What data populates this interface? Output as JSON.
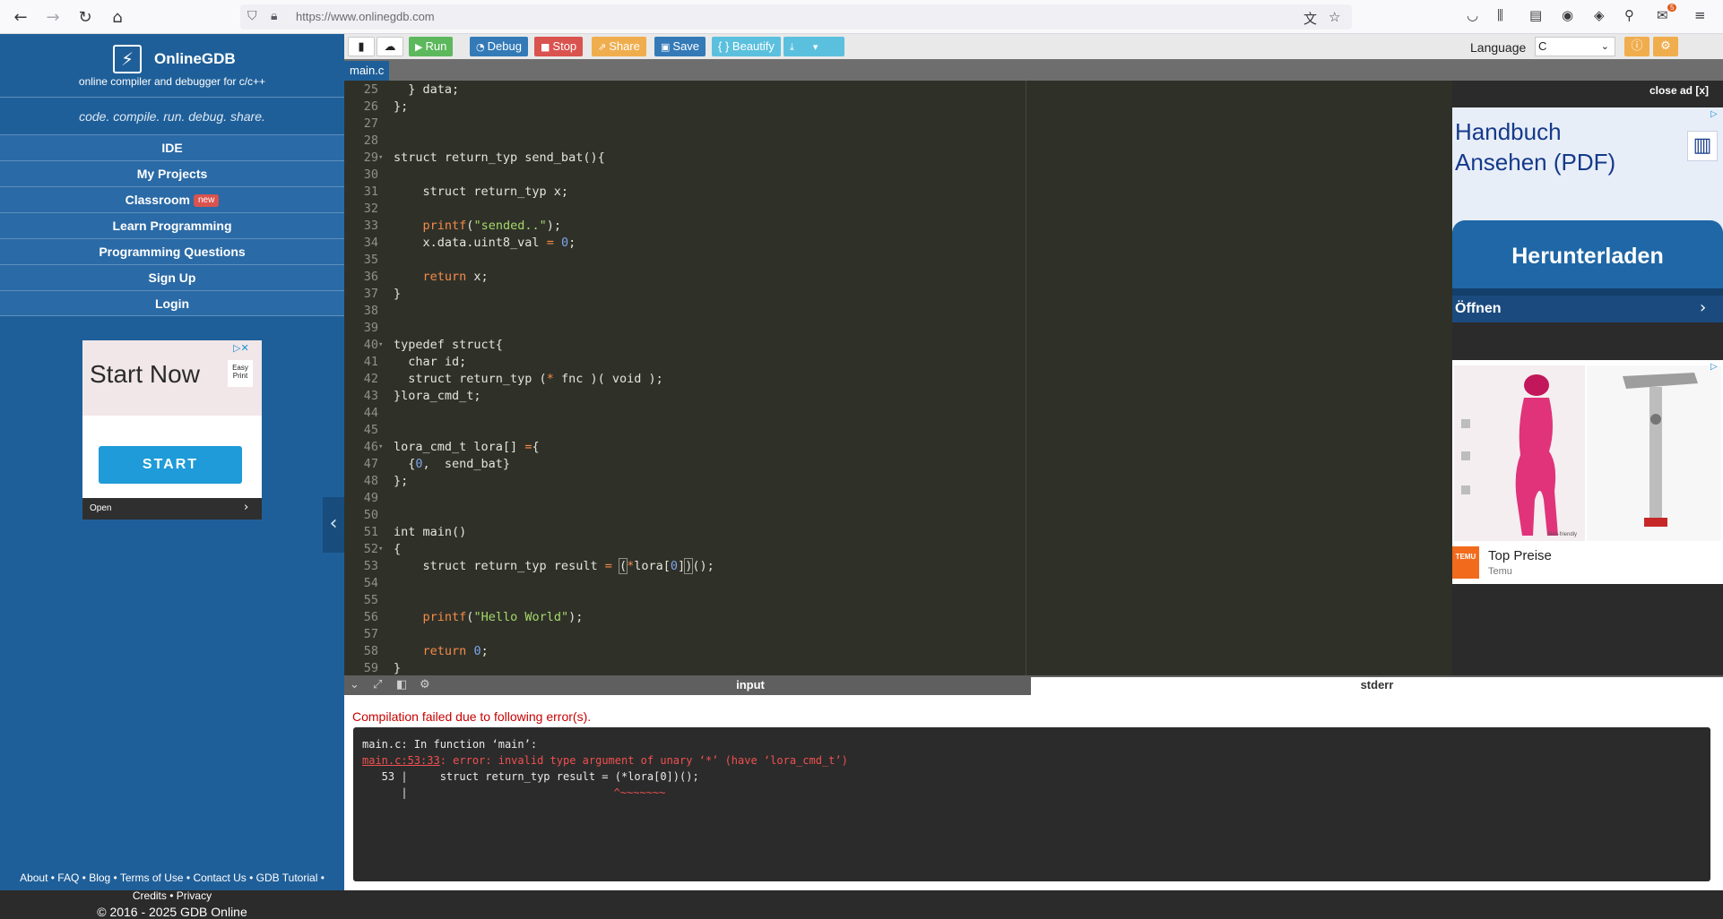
{
  "browser": {
    "url": "https://www.onlinegdb.com",
    "extension_badge": "5"
  },
  "sidebar": {
    "brand": "OnlineGDB",
    "tagline": "online compiler and debugger for c/c++",
    "motto": "code. compile. run. debug. share.",
    "menu": [
      {
        "label": "IDE"
      },
      {
        "label": "My Projects"
      },
      {
        "label": "Classroom",
        "badge": "new"
      },
      {
        "label": "Learn Programming"
      },
      {
        "label": "Programming Questions"
      },
      {
        "label": "Sign Up"
      },
      {
        "label": "Login"
      }
    ],
    "ad": {
      "title": "Start Now",
      "logo": "Easy Print",
      "button": "START",
      "footer": "Open"
    },
    "footer": {
      "links": [
        "About",
        "FAQ",
        "Blog",
        "Terms of Use",
        "Contact Us",
        "GDB Tutorial",
        "Credits",
        "Privacy"
      ],
      "copyright": "© 2016 - 2025 GDB Online"
    }
  },
  "toolbar": {
    "run": "Run",
    "debug": "Debug",
    "stop": "Stop",
    "share": "Share",
    "save": "Save",
    "beautify": "{ } Beautify",
    "language_label": "Language",
    "language_value": "C",
    "colors": {
      "run": "#5cb85c",
      "debug": "#337ab7",
      "stop": "#d9534f",
      "share": "#f0ad4e",
      "save": "#337ab7",
      "beautify": "#5bc0de",
      "download": "#5bc0de"
    }
  },
  "file_tab": "main.c",
  "editor": {
    "lines": [
      {
        "n": "25",
        "fold": "",
        "html": "  } data;"
      },
      {
        "n": "26",
        "fold": "",
        "html": "};"
      },
      {
        "n": "27",
        "fold": "",
        "html": ""
      },
      {
        "n": "28",
        "fold": "",
        "html": ""
      },
      {
        "n": "29",
        "fold": "▾",
        "html": "struct return_typ send_bat(){"
      },
      {
        "n": "30",
        "fold": "",
        "html": ""
      },
      {
        "n": "31",
        "fold": "",
        "html": "    struct return_typ x;"
      },
      {
        "n": "32",
        "fold": "",
        "html": ""
      },
      {
        "n": "33",
        "fold": "",
        "html": "    <span class=\"kw\">printf</span>(<span class=\"str\">\"sended..\"</span>);"
      },
      {
        "n": "34",
        "fold": "",
        "html": "    x.data.uint8_val <span class=\"op\">=</span> <span class=\"num\">0</span>;"
      },
      {
        "n": "35",
        "fold": "",
        "html": ""
      },
      {
        "n": "36",
        "fold": "",
        "html": "    <span class=\"kw\">return</span> x;"
      },
      {
        "n": "37",
        "fold": "",
        "html": "}"
      },
      {
        "n": "38",
        "fold": "",
        "html": ""
      },
      {
        "n": "39",
        "fold": "",
        "html": ""
      },
      {
        "n": "40",
        "fold": "▾",
        "html": "typedef struct{"
      },
      {
        "n": "41",
        "fold": "",
        "html": "  char id;"
      },
      {
        "n": "42",
        "fold": "",
        "html": "  struct return_typ (<span class=\"op\">*</span> fnc )( void );"
      },
      {
        "n": "43",
        "fold": "",
        "html": "}lora_cmd_t;"
      },
      {
        "n": "44",
        "fold": "",
        "html": ""
      },
      {
        "n": "45",
        "fold": "",
        "html": ""
      },
      {
        "n": "46",
        "fold": "▾",
        "html": "lora_cmd_t lora[] <span class=\"op\">=</span>{"
      },
      {
        "n": "47",
        "fold": "",
        "html": "  {<span class=\"num\">0</span>,  send_bat}"
      },
      {
        "n": "48",
        "fold": "",
        "html": "};"
      },
      {
        "n": "49",
        "fold": "",
        "html": ""
      },
      {
        "n": "50",
        "fold": "",
        "html": ""
      },
      {
        "n": "51",
        "fold": "",
        "html": "int main()"
      },
      {
        "n": "52",
        "fold": "▾",
        "html": "{"
      },
      {
        "n": "53",
        "fold": "",
        "html": "    struct return_typ result <span class=\"op\">=</span> <span class=\"bracket\">(</span><span class=\"op\">*</span>lora[<span class=\"num\">0</span>]<span class=\"bracket\">)</span>();"
      },
      {
        "n": "54",
        "fold": "",
        "html": ""
      },
      {
        "n": "55",
        "fold": "",
        "html": ""
      },
      {
        "n": "56",
        "fold": "",
        "html": "    <span class=\"kw\">printf</span>(<span class=\"str\">\"Hello World\"</span>);"
      },
      {
        "n": "57",
        "fold": "",
        "html": ""
      },
      {
        "n": "58",
        "fold": "",
        "html": "    <span class=\"kw\">return</span> <span class=\"num\">0</span>;"
      },
      {
        "n": "59",
        "fold": "",
        "html": "}"
      }
    ]
  },
  "right_ad": {
    "close": "close ad [x]",
    "ad1": {
      "headline_line1": "Handbuch",
      "headline_line2": "Ansehen (PDF)",
      "button": "Herunterladen",
      "open": "Öffnen"
    },
    "ad2": {
      "title": "Top Preise",
      "sub": "Temu",
      "logo": "TEMU",
      "img_caption": "Skin-friendly"
    }
  },
  "io": {
    "tab_input": "input",
    "tab_stderr": "stderr",
    "status": "Compilation failed due to following error(s).",
    "console": {
      "line1": "main.c: In function ‘main’:",
      "err_loc": "main.c:53:33",
      "err_msg": ": error: invalid type argument of unary ‘*’ (have ‘lora_cmd_t’)",
      "line3": "   53 |     struct return_typ result = (*lora[0])();",
      "line4_bar": "      |",
      "line4_caret": "^~~~~~~~"
    }
  }
}
